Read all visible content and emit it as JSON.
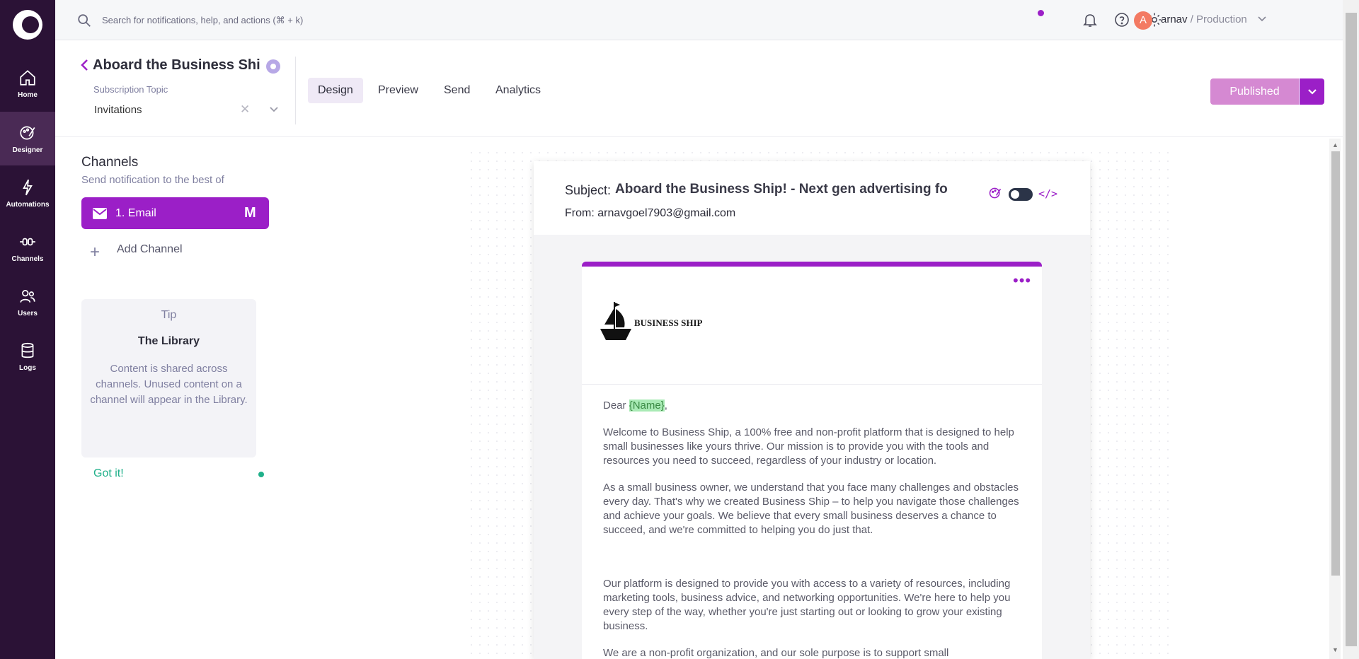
{
  "sidebar": {
    "items": [
      {
        "label": "Home",
        "icon": "home-icon"
      },
      {
        "label": "Designer",
        "icon": "palette-icon",
        "active": true
      },
      {
        "label": "Automations",
        "icon": "lightning-icon"
      },
      {
        "label": "Channels",
        "icon": "plug-icon"
      },
      {
        "label": "Users",
        "icon": "users-icon"
      },
      {
        "label": "Logs",
        "icon": "database-icon"
      }
    ]
  },
  "topbar": {
    "search_placeholder": "Search for notifications, help, and actions (⌘ + k)",
    "avatar_initial": "A",
    "user_name": "arnav",
    "separator": " / ",
    "environment": "Production"
  },
  "header": {
    "title": "Aboard the Business Shi",
    "subscription_topic_label": "Subscription Topic",
    "subscription_topic_value": "Invitations",
    "tabs": [
      {
        "label": "Design",
        "active": true
      },
      {
        "label": "Preview"
      },
      {
        "label": "Send"
      },
      {
        "label": "Analytics"
      }
    ],
    "status_button": "Published"
  },
  "channels": {
    "title": "Channels",
    "subtitle": "Send notification to the best of",
    "items": [
      {
        "label": "1.  Email",
        "provider_glyph": "M"
      }
    ],
    "add_label": "Add Channel"
  },
  "tip": {
    "heading": "Tip",
    "title": "The Library",
    "body": "Content is shared across channels. Unused content on a channel will appear in the Library.",
    "action": "Got it!"
  },
  "email": {
    "subject_label": "Subject:",
    "subject": "Aboard the Business Ship! - Next gen advertising fo",
    "from_label": "From:",
    "from": "arnavgoel7903@gmail.com",
    "code_toggle": "</>",
    "brand_name": "BUSINESS SHIP",
    "greeting_prefix": "Dear ",
    "greeting_var": "{Name}",
    "greeting_suffix": ",",
    "paragraphs": [
      "Welcome to Business Ship, a 100% free and non-profit platform that is designed to help small businesses like yours thrive. Our mission is to provide you with the tools and resources you need to succeed, regardless of your industry or location.",
      "As a small business owner, we understand that you face many challenges and obstacles every day. That's why we created Business Ship – to help you navigate those challenges and achieve your goals. We believe that every small business deserves a chance to succeed, and we're committed to helping you do just that.",
      "Our platform is designed to provide you with access to a variety of resources, including marketing tools, business advice, and networking opportunities. We're here to help you every step of the way, whether you're just starting out or looking to grow your existing business.",
      "We are a non-profit organization, and our sole purpose is to support small"
    ]
  },
  "colors": {
    "accent": "#9b1fc7",
    "sidebar_bg": "#2b1236",
    "published": "#d589d2",
    "success": "#20b08a"
  }
}
